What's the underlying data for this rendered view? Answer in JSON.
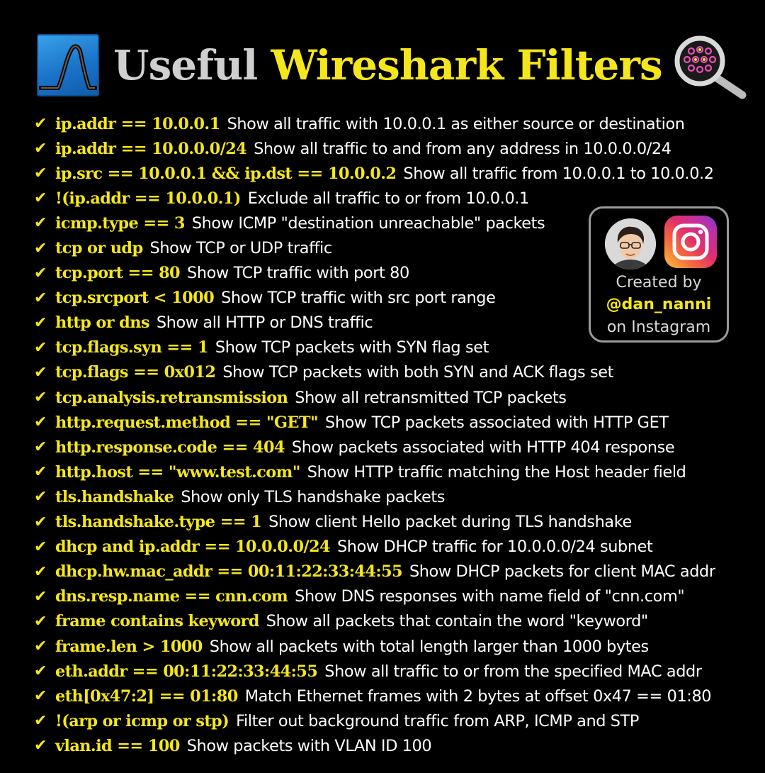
{
  "header": {
    "title_part1": "Useful",
    "title_part2": "Wireshark Filters",
    "logo_icon": "wireshark-fin-icon",
    "search_icon": "magnifier-packets-icon"
  },
  "colors": {
    "accent": "#f5e61b",
    "text": "#ffffff",
    "background": "#000000"
  },
  "check_mark": "✔",
  "filters": [
    {
      "filter": "ip.addr == 10.0.0.1",
      "description": "Show all traffic with 10.0.0.1 as either source or destination"
    },
    {
      "filter": "ip.addr == 10.0.0.0/24",
      "description": "Show all traffic to and from any address in 10.0.0.0/24"
    },
    {
      "filter": "ip.src == 10.0.0.1 && ip.dst == 10.0.0.2",
      "description": "Show all traffic from 10.0.0.1 to 10.0.0.2"
    },
    {
      "filter": "!(ip.addr == 10.0.0.1)",
      "description": "Exclude all traffic to or from 10.0.0.1"
    },
    {
      "filter": "icmp.type == 3",
      "description": "Show ICMP \"destination unreachable\" packets"
    },
    {
      "filter": "tcp or udp",
      "description": "Show TCP or UDP traffic"
    },
    {
      "filter": "tcp.port == 80",
      "description": "Show TCP traffic with port 80"
    },
    {
      "filter": "tcp.srcport < 1000",
      "description": "Show TCP traffic with src port range"
    },
    {
      "filter": "http or dns",
      "description": "Show all HTTP or DNS traffic"
    },
    {
      "filter": "tcp.flags.syn == 1",
      "description": "Show TCP packets with SYN flag set"
    },
    {
      "filter": "tcp.flags == 0x012",
      "description": "Show TCP packets with both SYN and ACK flags set"
    },
    {
      "filter": "tcp.analysis.retransmission",
      "description": "Show all retransmitted TCP packets"
    },
    {
      "filter": "http.request.method == \"GET\"",
      "description": "Show TCP packets associated with HTTP GET"
    },
    {
      "filter": "http.response.code == 404",
      "description": "Show packets associated with HTTP 404 response"
    },
    {
      "filter": "http.host == \"www.test.com\"",
      "description": "Show HTTP traffic matching the Host header field"
    },
    {
      "filter": "tls.handshake",
      "description": "Show only TLS handshake packets"
    },
    {
      "filter": "tls.handshake.type == 1",
      "description": "Show client Hello packet during TLS handshake"
    },
    {
      "filter": "dhcp and ip.addr == 10.0.0.0/24",
      "description": "Show DHCP traffic for 10.0.0.0/24 subnet"
    },
    {
      "filter": "dhcp.hw.mac_addr == 00:11:22:33:44:55",
      "description": "Show DHCP packets for client MAC addr"
    },
    {
      "filter": "dns.resp.name == cnn.com",
      "description": "Show DNS responses with name field of \"cnn.com\""
    },
    {
      "filter": "frame contains keyword",
      "description": "Show all packets that contain the word \"keyword\""
    },
    {
      "filter": "frame.len > 1000",
      "description": "Show all packets with total length larger than 1000 bytes"
    },
    {
      "filter": "eth.addr == 00:11:22:33:44:55",
      "description": "Show all traffic to or from the specified MAC addr"
    },
    {
      "filter": "eth[0x47:2] == 01:80",
      "description": "Match Ethernet frames with 2 bytes at offset 0x47 == 01:80"
    },
    {
      "filter": "!(arp or icmp or stp)",
      "description": "Filter out background traffic from ARP, ICMP and STP"
    },
    {
      "filter": "vlan.id == 100",
      "description": "Show packets with VLAN ID 100"
    }
  ],
  "creator_card": {
    "line1": "Created by",
    "handle": "@dan_nanni",
    "line3": "on Instagram",
    "avatar_icon": "avatar-icon",
    "instagram_icon": "instagram-icon"
  }
}
